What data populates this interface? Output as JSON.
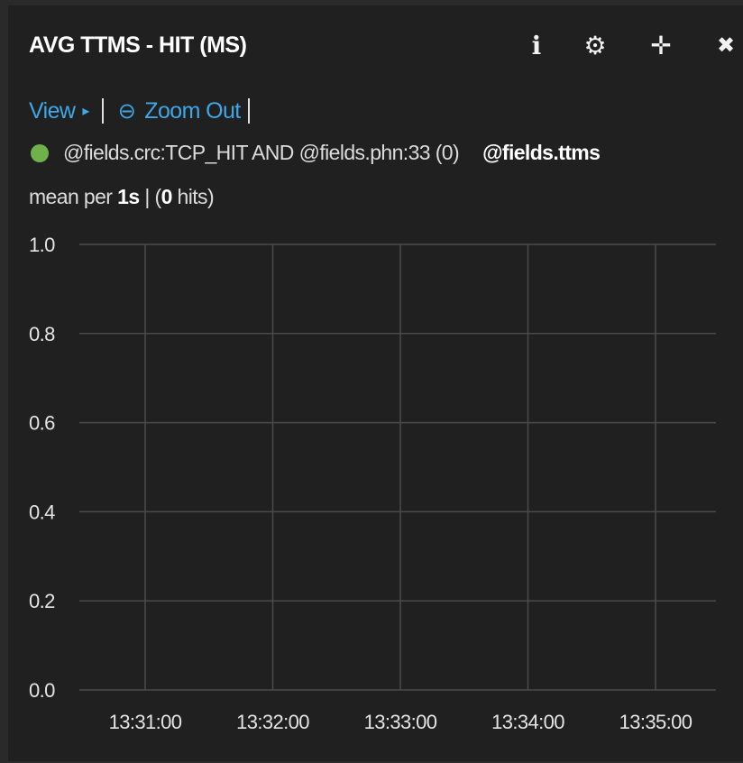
{
  "panel": {
    "title": "AVG TTMS - HIT (MS)",
    "controls": [
      {
        "name": "info-icon",
        "glyph": "ℹ"
      },
      {
        "name": "gear-icon",
        "glyph": "⚙"
      },
      {
        "name": "move-icon",
        "glyph": "✛"
      },
      {
        "name": "close-icon",
        "glyph": "✖"
      }
    ]
  },
  "toolbar": {
    "view_label": "View",
    "view_caret": "▸",
    "zoom_icon": "⊖",
    "zoom_label": "Zoom Out"
  },
  "legend": {
    "series_color": "#6fb24b",
    "query": "@fields.crc:TCP_HIT AND @fields.phn:33 (0)",
    "field": "@fields.ttms"
  },
  "stats": {
    "prefix": "mean per ",
    "interval": "1s",
    "middle": " | (",
    "hits": "0",
    "suffix": " hits)"
  },
  "chart_data": {
    "type": "line",
    "x": [
      "13:31:00",
      "13:32:00",
      "13:33:00",
      "13:34:00",
      "13:35:00"
    ],
    "series": [],
    "yticks": [
      "1.0",
      "0.8",
      "0.6",
      "0.4",
      "0.2",
      "0.0"
    ],
    "ylim": [
      0,
      1
    ],
    "grid": true,
    "colors": {
      "grid": "#4a4a4a",
      "text": "#e4e4e4"
    }
  }
}
